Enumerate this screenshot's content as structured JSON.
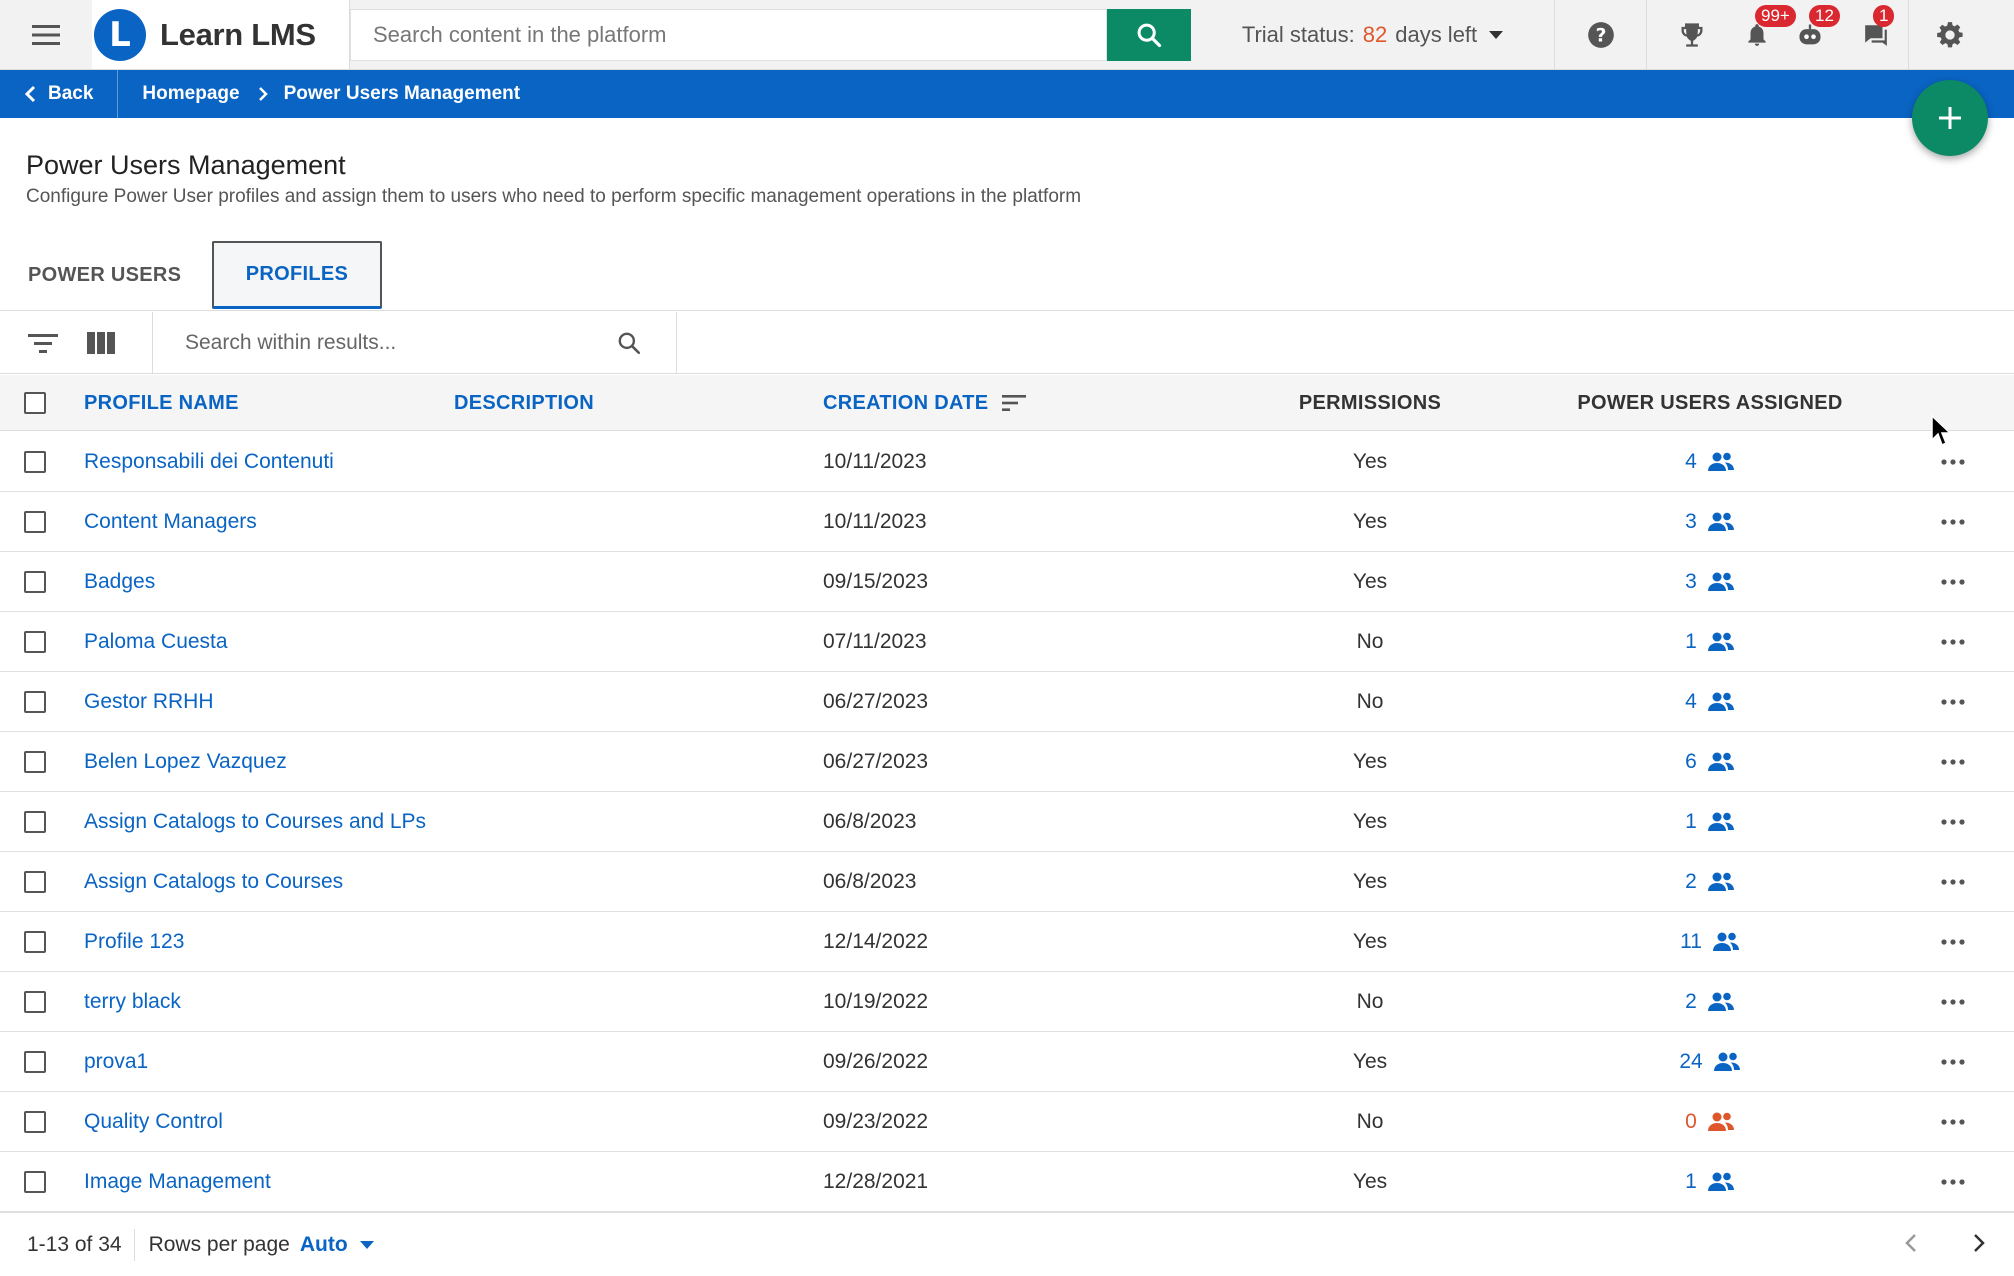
{
  "app": {
    "name": "Learn LMS",
    "logo_letter": "L"
  },
  "search": {
    "placeholder": "Search content in the platform"
  },
  "trial": {
    "label": "Trial status:",
    "days": "82",
    "suffix": "days left"
  },
  "notifications": {
    "badge_bell": "99+",
    "badge_robot": "12",
    "badge_chat": "1"
  },
  "breadcrumb": {
    "back": "Back",
    "home": "Homepage",
    "current": "Power Users Management"
  },
  "page": {
    "title": "Power Users Management",
    "subtitle": "Configure Power User profiles and assign them to users who need to perform specific management operations in the platform"
  },
  "tabs": [
    {
      "label": "POWER USERS",
      "active": false
    },
    {
      "label": "PROFILES",
      "active": true
    }
  ],
  "results_search": {
    "placeholder": "Search within results..."
  },
  "table": {
    "columns": {
      "name": "PROFILE NAME",
      "description": "DESCRIPTION",
      "date": "CREATION DATE",
      "permissions": "PERMISSIONS",
      "users": "POWER USERS ASSIGNED"
    },
    "rows": [
      {
        "name": "Responsabili dei Contenuti",
        "date": "10/11/2023",
        "permissions": "Yes",
        "users": "4"
      },
      {
        "name": "Content Managers",
        "date": "10/11/2023",
        "permissions": "Yes",
        "users": "3"
      },
      {
        "name": "Badges",
        "date": "09/15/2023",
        "permissions": "Yes",
        "users": "3"
      },
      {
        "name": "Paloma Cuesta",
        "date": "07/11/2023",
        "permissions": "No",
        "users": "1"
      },
      {
        "name": "Gestor RRHH",
        "date": "06/27/2023",
        "permissions": "No",
        "users": "4"
      },
      {
        "name": "Belen Lopez Vazquez",
        "date": "06/27/2023",
        "permissions": "Yes",
        "users": "6"
      },
      {
        "name": "Assign Catalogs to Courses and LPs",
        "date": "06/8/2023",
        "permissions": "Yes",
        "users": "1"
      },
      {
        "name": "Assign Catalogs to Courses",
        "date": "06/8/2023",
        "permissions": "Yes",
        "users": "2"
      },
      {
        "name": "Profile 123",
        "date": "12/14/2022",
        "permissions": "Yes",
        "users": "11"
      },
      {
        "name": "terry black",
        "date": "10/19/2022",
        "permissions": "No",
        "users": "2"
      },
      {
        "name": "prova1",
        "date": "09/26/2022",
        "permissions": "Yes",
        "users": "24"
      },
      {
        "name": "Quality Control",
        "date": "09/23/2022",
        "permissions": "No",
        "users": "0"
      },
      {
        "name": "Image Management",
        "date": "12/28/2021",
        "permissions": "Yes",
        "users": "1"
      }
    ]
  },
  "pagination": {
    "range": "1-13 of 34",
    "rows_label": "Rows per page",
    "rows_value": "Auto"
  },
  "colors": {
    "accent": "#0a64c4",
    "brand_green": "#0b8a65",
    "warning": "#e0562b",
    "badge": "#d9282f"
  },
  "icons": {
    "menu": "hamburger-menu-icon",
    "search": "search-icon",
    "help": "help-icon",
    "trophy": "trophy-icon",
    "bell": "bell-icon",
    "robot": "robot-icon",
    "chat": "chat-icon",
    "settings": "gear-icon",
    "users": "users-icon",
    "more": "more-horizontal-icon",
    "filter": "filter-icon",
    "columns": "columns-icon"
  }
}
